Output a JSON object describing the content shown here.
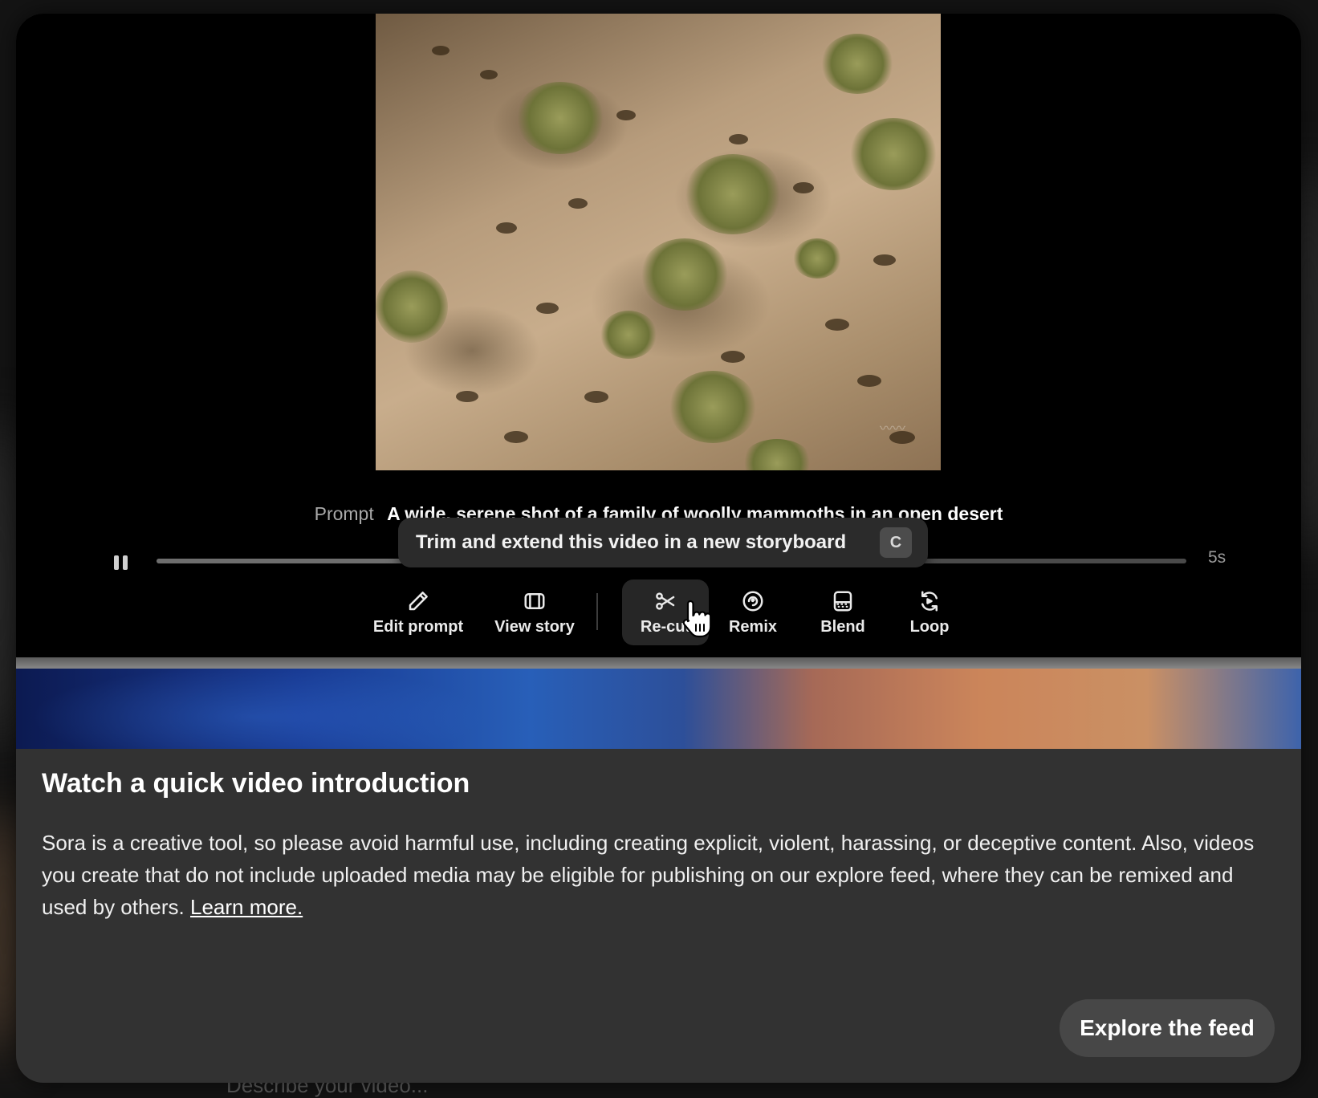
{
  "background": {
    "input_placeholder": "Describe your video..."
  },
  "player": {
    "prompt_label": "Prompt",
    "prompt_text": "A wide, serene shot of a family of woolly mammoths in an open desert",
    "duration": "5s",
    "tooltip": {
      "text": "Trim and extend this video in a new storyboard",
      "shortcut": "C"
    },
    "actions": [
      {
        "label": "Edit prompt",
        "icon": "pencil-icon"
      },
      {
        "label": "View story",
        "icon": "storyboard-icon"
      },
      {
        "label": "Re-cut",
        "icon": "scissors-icon",
        "active": true
      },
      {
        "label": "Remix",
        "icon": "remix-icon"
      },
      {
        "label": "Blend",
        "icon": "blend-icon"
      },
      {
        "label": "Loop",
        "icon": "loop-icon"
      }
    ]
  },
  "intro": {
    "title": "Watch a quick video introduction",
    "body": "Sora is a creative tool, so please avoid harmful use, including creating explicit, violent, harassing, or deceptive content. Also, videos you create that do not include uploaded media may be eligible for publishing on our explore feed, where they can be remixed and used by others.",
    "learn_more": "Learn more."
  },
  "cta": {
    "explore_label": "Explore the feed"
  },
  "colors": {
    "modal_bg": "#323232",
    "player_bg": "#000000",
    "button_bg": "#474747"
  }
}
